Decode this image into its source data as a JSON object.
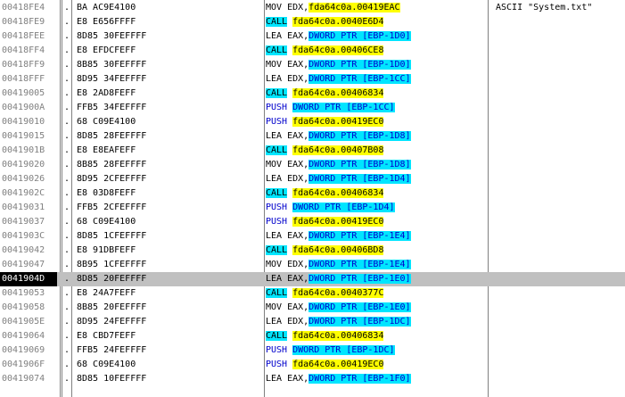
{
  "rows": [
    {
      "addr": "00418FE4",
      "dot": ".",
      "hex": "BA AC9E4100",
      "op": "MOV EDX,",
      "op_kind": "mov",
      "target": "fda64c0a.00419EAC",
      "mem": "",
      "mem_hl": false,
      "comment": "ASCII \"System.txt\""
    },
    {
      "addr": "00418FE9",
      "dot": ".",
      "hex": "E8 E656FFFF",
      "op": "CALL",
      "op_kind": "call",
      "target": "fda64c0a.0040E6D4",
      "mem": "",
      "mem_hl": false,
      "comment": ""
    },
    {
      "addr": "00418FEE",
      "dot": ".",
      "hex": "8D85 30FEFFFF",
      "op": "LEA EAX,",
      "op_kind": "lea",
      "target": "",
      "mem": "DWORD PTR [EBP-1D0]",
      "mem_hl": true,
      "comment": ""
    },
    {
      "addr": "00418FF4",
      "dot": ".",
      "hex": "E8 EFDCFEFF",
      "op": "CALL",
      "op_kind": "call",
      "target": "fda64c0a.00406CE8",
      "mem": "",
      "mem_hl": false,
      "comment": ""
    },
    {
      "addr": "00418FF9",
      "dot": ".",
      "hex": "8B85 30FEFFFF",
      "op": "MOV EAX,",
      "op_kind": "mov",
      "target": "",
      "mem": "DWORD PTR [EBP-1D0]",
      "mem_hl": true,
      "comment": ""
    },
    {
      "addr": "00418FFF",
      "dot": ".",
      "hex": "8D95 34FEFFFF",
      "op": "LEA EDX,",
      "op_kind": "lea",
      "target": "",
      "mem": "DWORD PTR [EBP-1CC]",
      "mem_hl": true,
      "comment": ""
    },
    {
      "addr": "00419005",
      "dot": ".",
      "hex": "E8 2AD8FEFF",
      "op": "CALL",
      "op_kind": "call",
      "target": "fda64c0a.00406834",
      "mem": "",
      "mem_hl": false,
      "comment": ""
    },
    {
      "addr": "0041900A",
      "dot": ".",
      "hex": "FFB5 34FEFFFF",
      "op": "PUSH",
      "op_kind": "push",
      "target": "",
      "mem": "DWORD PTR [EBP-1CC]",
      "mem_hl": true,
      "comment": ""
    },
    {
      "addr": "00419010",
      "dot": ".",
      "hex": "68 C09E4100",
      "op": "PUSH",
      "op_kind": "push",
      "target": "fda64c0a.00419EC0",
      "mem": "",
      "mem_hl": false,
      "comment": ""
    },
    {
      "addr": "00419015",
      "dot": ".",
      "hex": "8D85 28FEFFFF",
      "op": "LEA EAX,",
      "op_kind": "lea",
      "target": "",
      "mem": "DWORD PTR [EBP-1D8]",
      "mem_hl": true,
      "comment": ""
    },
    {
      "addr": "0041901B",
      "dot": ".",
      "hex": "E8 E8EAFEFF",
      "op": "CALL",
      "op_kind": "call",
      "target": "fda64c0a.00407B08",
      "mem": "",
      "mem_hl": false,
      "comment": ""
    },
    {
      "addr": "00419020",
      "dot": ".",
      "hex": "8B85 28FEFFFF",
      "op": "MOV EAX,",
      "op_kind": "mov",
      "target": "",
      "mem": "DWORD PTR [EBP-1D8]",
      "mem_hl": true,
      "comment": ""
    },
    {
      "addr": "00419026",
      "dot": ".",
      "hex": "8D95 2CFEFFFF",
      "op": "LEA EDX,",
      "op_kind": "lea",
      "target": "",
      "mem": "DWORD PTR [EBP-1D4]",
      "mem_hl": true,
      "comment": ""
    },
    {
      "addr": "0041902C",
      "dot": ".",
      "hex": "E8 03D8FEFF",
      "op": "CALL",
      "op_kind": "call",
      "target": "fda64c0a.00406834",
      "mem": "",
      "mem_hl": false,
      "comment": ""
    },
    {
      "addr": "00419031",
      "dot": ".",
      "hex": "FFB5 2CFEFFFF",
      "op": "PUSH",
      "op_kind": "push",
      "target": "",
      "mem": "DWORD PTR [EBP-1D4]",
      "mem_hl": true,
      "comment": ""
    },
    {
      "addr": "00419037",
      "dot": ".",
      "hex": "68 C09E4100",
      "op": "PUSH",
      "op_kind": "push",
      "target": "fda64c0a.00419EC0",
      "mem": "",
      "mem_hl": false,
      "comment": ""
    },
    {
      "addr": "0041903C",
      "dot": ".",
      "hex": "8D85 1CFEFFFF",
      "op": "LEA EAX,",
      "op_kind": "lea",
      "target": "",
      "mem": "DWORD PTR [EBP-1E4]",
      "mem_hl": true,
      "comment": ""
    },
    {
      "addr": "00419042",
      "dot": ".",
      "hex": "E8 91DBFEFF",
      "op": "CALL",
      "op_kind": "call",
      "target": "fda64c0a.00406BD8",
      "mem": "",
      "mem_hl": false,
      "comment": ""
    },
    {
      "addr": "00419047",
      "dot": ".",
      "hex": "8B95 1CFEFFFF",
      "op": "MOV EDX,",
      "op_kind": "mov",
      "target": "",
      "mem": "DWORD PTR [EBP-1E4]",
      "mem_hl": true,
      "comment": ""
    },
    {
      "addr": "0041904D",
      "dot": ".",
      "hex": "8D85 20FEFFFF",
      "op": "LEA EAX,",
      "op_kind": "lea",
      "target": "",
      "mem": "DWORD PTR [EBP-1E0]",
      "mem_hl": true,
      "comment": "",
      "selected": true
    },
    {
      "addr": "00419053",
      "dot": ".",
      "hex": "E8 24A7FEFF",
      "op": "CALL",
      "op_kind": "call",
      "target": "fda64c0a.0040377C",
      "mem": "",
      "mem_hl": false,
      "comment": ""
    },
    {
      "addr": "00419058",
      "dot": ".",
      "hex": "8B85 20FEFFFF",
      "op": "MOV EAX,",
      "op_kind": "mov",
      "target": "",
      "mem": "DWORD PTR [EBP-1E0]",
      "mem_hl": true,
      "comment": ""
    },
    {
      "addr": "0041905E",
      "dot": ".",
      "hex": "8D95 24FEFFFF",
      "op": "LEA EDX,",
      "op_kind": "lea",
      "target": "",
      "mem": "DWORD PTR [EBP-1DC]",
      "mem_hl": true,
      "comment": ""
    },
    {
      "addr": "00419064",
      "dot": ".",
      "hex": "E8 CBD7FEFF",
      "op": "CALL",
      "op_kind": "call",
      "target": "fda64c0a.00406834",
      "mem": "",
      "mem_hl": false,
      "comment": ""
    },
    {
      "addr": "00419069",
      "dot": ".",
      "hex": "FFB5 24FEFFFF",
      "op": "PUSH",
      "op_kind": "push",
      "target": "",
      "mem": "DWORD PTR [EBP-1DC]",
      "mem_hl": true,
      "comment": ""
    },
    {
      "addr": "0041906F",
      "dot": ".",
      "hex": "68 C09E4100",
      "op": "PUSH",
      "op_kind": "push",
      "target": "fda64c0a.00419EC0",
      "mem": "",
      "mem_hl": false,
      "comment": ""
    },
    {
      "addr": "00419074",
      "dot": ".",
      "hex": "8D85 10FEFFFF",
      "op": "LEA EAX,",
      "op_kind": "lea",
      "target": "",
      "mem": "DWORD PTR [EBP-1F0]",
      "mem_hl": true,
      "comment": ""
    }
  ],
  "colors": {
    "call_bg": "#00e5ff",
    "target_bg": "#ffff00",
    "push_fg": "#0000cc",
    "selected_row": "#c0c0c0",
    "selected_addr": "#000000"
  }
}
